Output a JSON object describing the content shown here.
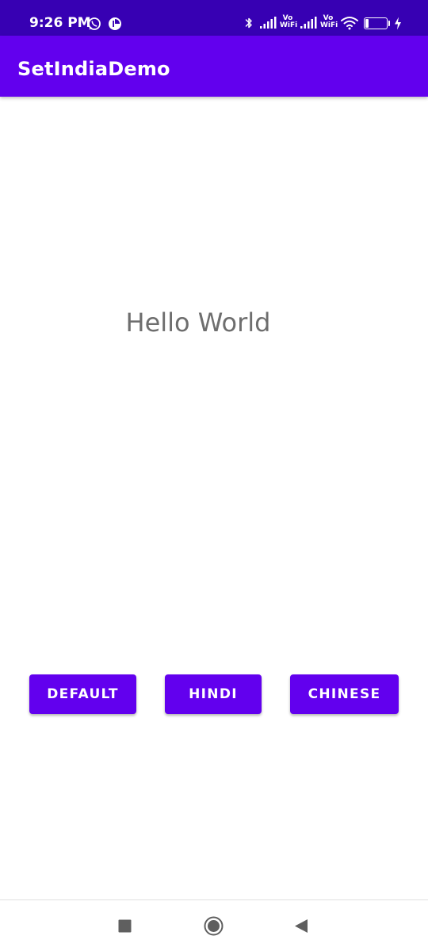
{
  "status_bar": {
    "time": "9:26 PM",
    "vowifi_top": "Vo",
    "vowifi_bottom": "WiFi",
    "battery_level": "21"
  },
  "app_bar": {
    "title": "SetIndiaDemo"
  },
  "main": {
    "message": "Hello World",
    "buttons": [
      {
        "label": "DEFAULT"
      },
      {
        "label": "HINDI"
      },
      {
        "label": "CHINESE"
      }
    ]
  },
  "nav_bar": {
    "icons": [
      "recents-square-icon",
      "home-circle-icon",
      "back-triangle-icon"
    ]
  },
  "colors": {
    "status_bar": "#3700b3",
    "primary": "#6200ee",
    "text_secondary": "#6e6e6e"
  }
}
